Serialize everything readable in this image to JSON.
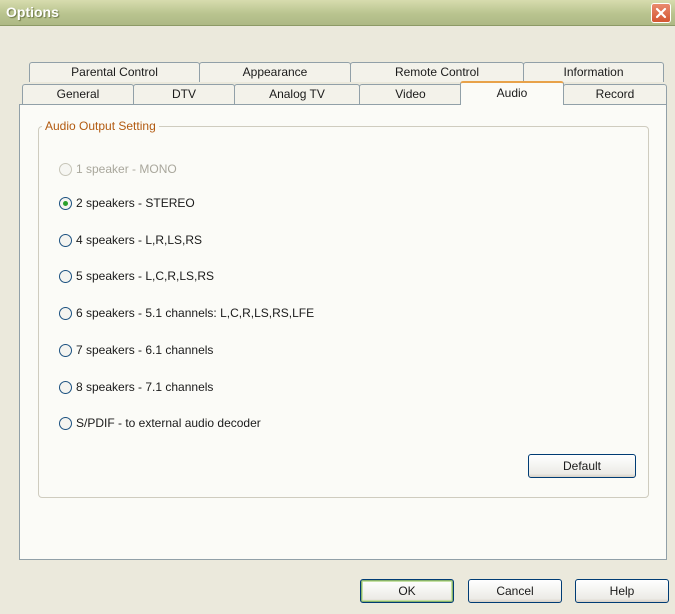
{
  "window": {
    "title": "Options",
    "close_icon": "close-icon"
  },
  "tabs": {
    "row_back": [
      {
        "label": "Parental Control"
      },
      {
        "label": "Appearance"
      },
      {
        "label": "Remote Control"
      },
      {
        "label": "Information"
      }
    ],
    "row_front": [
      {
        "label": "General"
      },
      {
        "label": "DTV"
      },
      {
        "label": "Analog TV"
      },
      {
        "label": "Video"
      },
      {
        "label": "Audio",
        "active": true
      },
      {
        "label": "Record"
      }
    ]
  },
  "audio": {
    "group_label": "Audio Output Setting",
    "options": [
      {
        "label": "1 speaker - MONO",
        "checked": false,
        "disabled": true
      },
      {
        "label": "2 speakers - STEREO",
        "checked": true,
        "disabled": false
      },
      {
        "label": "4 speakers - L,R,LS,RS",
        "checked": false,
        "disabled": false
      },
      {
        "label": "5 speakers - L,C,R,LS,RS",
        "checked": false,
        "disabled": false
      },
      {
        "label": "6 speakers - 5.1 channels: L,C,R,LS,RS,LFE",
        "checked": false,
        "disabled": false
      },
      {
        "label": "7 speakers - 6.1 channels",
        "checked": false,
        "disabled": false
      },
      {
        "label": "8 speakers - 7.1 channels",
        "checked": false,
        "disabled": false
      },
      {
        "label": "S/PDIF - to external audio decoder",
        "checked": false,
        "disabled": false
      }
    ],
    "default_button": "Default"
  },
  "buttons": {
    "ok": "OK",
    "cancel": "Cancel",
    "help": "Help"
  },
  "colors": {
    "accent_tab": "#e8a24a",
    "group_label": "#b25a10",
    "radio_checked": "#2aa02a",
    "close_button": "#d45632"
  }
}
